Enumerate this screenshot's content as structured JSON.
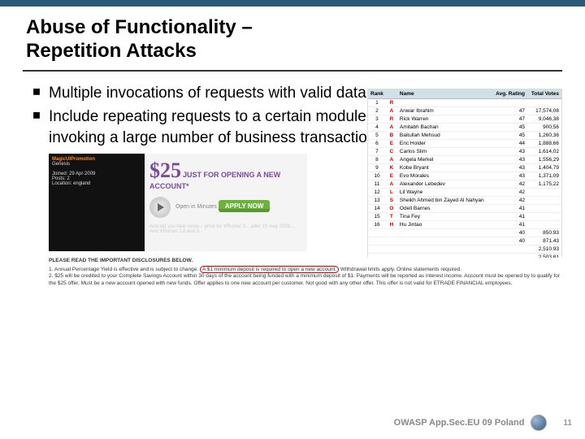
{
  "title_line1": "Abuse of Functionality –",
  "title_line2": "Repetition Attacks",
  "bullets": [
    "Multiple invocations of requests with valid data",
    "Include repeating requests to a certain module with the intention of invoking a large number of business transactions"
  ],
  "forum": {
    "title": "MagicUIPromotion",
    "sub": "Genesis",
    "joined": "Joined: 29 Apr 2009",
    "posts": "Posts: 2",
    "loc": "Location: england"
  },
  "ad": {
    "amount": "$25",
    "headline": "JUST FOR OPENING A NEW ACCOUNT*",
    "open_in": "Open in Minutes",
    "apply": "APPLY NOW",
    "below": "And did you hear news – price for XRumer 5... after 15 may 2009... And XRumer 2.9 and 3..."
  },
  "board": {
    "headers": [
      "Rank",
      "",
      "Name",
      "Avg. Rating",
      "Total Votes"
    ],
    "rows": [
      {
        "rank": 1,
        "l": "R",
        "name": "",
        "rating": "",
        "votes": ""
      },
      {
        "rank": 2,
        "l": "A",
        "name": "Anwar Ibrahim",
        "rating": "47",
        "votes": "17,574,08"
      },
      {
        "rank": 3,
        "l": "R",
        "name": "Rick Warren",
        "rating": "47",
        "votes": "9,046,38"
      },
      {
        "rank": 4,
        "l": "A",
        "name": "Amitabh Bachan",
        "rating": "45",
        "votes": "900,56"
      },
      {
        "rank": 5,
        "l": "B",
        "name": "Baitullah Mehsud",
        "rating": "45",
        "votes": "1,260,36"
      },
      {
        "rank": 6,
        "l": "E",
        "name": "Eric Holder",
        "rating": "44",
        "votes": "1,888,66"
      },
      {
        "rank": 7,
        "l": "C",
        "name": "Carlos Slim",
        "rating": "43",
        "votes": "1,614,02"
      },
      {
        "rank": 8,
        "l": "A",
        "name": "Angela Merkel",
        "rating": "43",
        "votes": "1,556,29"
      },
      {
        "rank": 9,
        "l": "K",
        "name": "Kobe Bryant",
        "rating": "43",
        "votes": "1,404,79"
      },
      {
        "rank": 10,
        "l": "E",
        "name": "Evo Morales",
        "rating": "43",
        "votes": "1,371,09"
      },
      {
        "rank": 11,
        "l": "A",
        "name": "Alexander Lebedev",
        "rating": "42",
        "votes": "1,175,22"
      },
      {
        "rank": 12,
        "l": "L",
        "name": "Lil Wayne",
        "rating": "42",
        "votes": ""
      },
      {
        "rank": 13,
        "l": "S",
        "name": "Sheikh Ahmed bin Zayed Al Nahyan",
        "rating": "42",
        "votes": ""
      },
      {
        "rank": 14,
        "l": "O",
        "name": "Odell Barnes",
        "rating": "41",
        "votes": ""
      },
      {
        "rank": 15,
        "l": "T",
        "name": "Tina Fey",
        "rating": "41",
        "votes": ""
      },
      {
        "rank": 16,
        "l": "H",
        "name": "Hu Jintao",
        "rating": "41",
        "votes": ""
      },
      {
        "rank": "",
        "l": "",
        "name": "",
        "rating": "40",
        "votes": "850.93"
      },
      {
        "rank": "",
        "l": "",
        "name": "",
        "rating": "40",
        "votes": "871.43"
      },
      {
        "rank": "",
        "l": "",
        "name": "",
        "rating": "",
        "votes": "2,510.93"
      },
      {
        "rank": "",
        "l": "",
        "name": "",
        "rating": "",
        "votes": "2,503.81"
      }
    ]
  },
  "disclosures": {
    "title": "PLEASE READ THE IMPORTANT DISCLOSURES BELOW.",
    "line1_a": "1. Annual Percentage Yield is effective and is subject to change.",
    "line1_b": "A $1 minimum deposit is required to open a new account.",
    "line1_c": "Withdrawal limits apply. Online statements required.",
    "line2": "2. $25 will be credited to your Complete Savings Account within 30 days of the account being funded with a minimum deposit of $1. Payments will be reported as interest income. Account must be opened by to qualify for the $25 offer. Must be a new account opened with new funds. Offer applies to one new account per customer. Not good with any other offer. This offer is not valid for ETRADE FINANCIAL employees."
  },
  "footer": {
    "conf": "OWASP App.Sec.EU 09 Poland",
    "page": "11"
  }
}
